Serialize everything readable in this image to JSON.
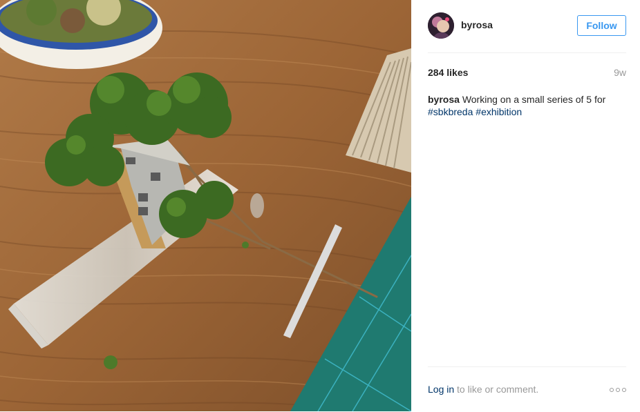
{
  "post": {
    "username": "byrosa",
    "follow_label": "Follow",
    "likes": "284 likes",
    "age": "9w",
    "caption": {
      "user": "byrosa",
      "text": "Working on a small series of 5 for",
      "hashtags": [
        "#sbkbreda",
        "#exhibition"
      ]
    },
    "footer": {
      "login_label": "Log in",
      "login_suffix": " to like or comment."
    }
  },
  "icons": {
    "avatar": "profile-avatar",
    "more": "more-options-icon"
  },
  "colors": {
    "accent": "#3897f0",
    "link": "#003569",
    "muted": "#999999",
    "text": "#262626",
    "divider": "#efefef"
  }
}
